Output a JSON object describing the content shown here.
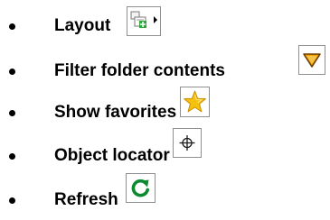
{
  "items": [
    {
      "label": "Layout",
      "icon": "layout-icon"
    },
    {
      "label": "Filter folder contents",
      "icon": "filter-icon"
    },
    {
      "label": "Show favorites",
      "icon": "star-icon"
    },
    {
      "label": "Object locator",
      "icon": "crosshair-icon"
    },
    {
      "label": "Refresh",
      "icon": "refresh-icon"
    }
  ],
  "colors": {
    "filter": "#f0a400",
    "star": "#f5c10c",
    "refresh": "#0c8a2f",
    "layout_plus": "#2fa83a"
  }
}
